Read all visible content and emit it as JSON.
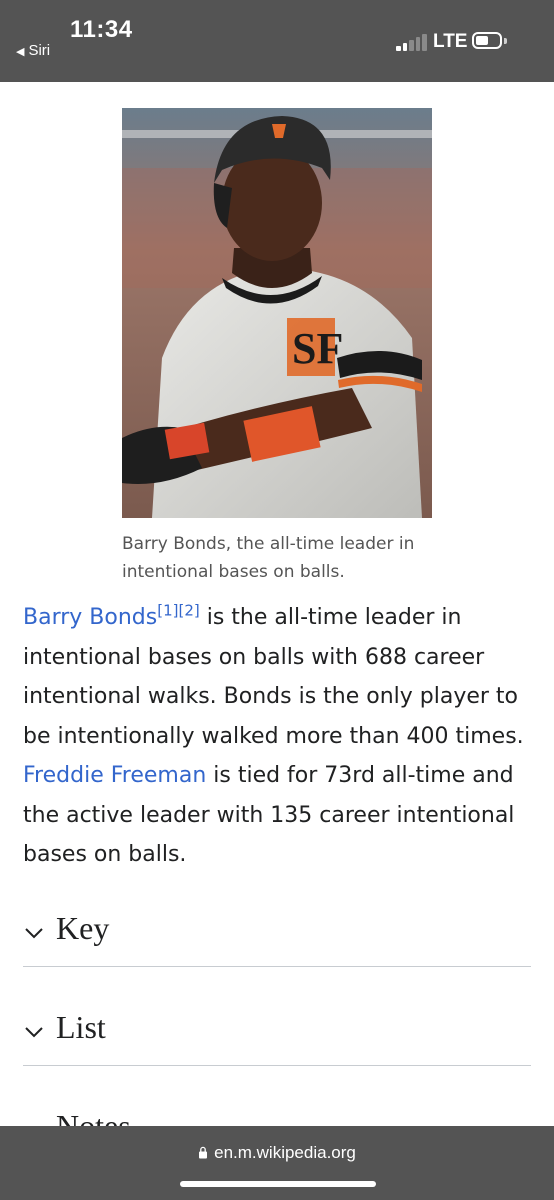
{
  "status_bar": {
    "time": "11:34",
    "back_label": "Siri",
    "network": "LTE"
  },
  "figure": {
    "caption": "Barry Bonds, the all-time leader in intentional bases on balls."
  },
  "paragraph": {
    "link_bonds": "Barry Bonds",
    "ref_1": "[1]",
    "ref_2": "[2]",
    "text_1": " is the all-time leader in intentional bases on balls with 688 career intentional walks. Bonds is the only player to be intentionally walked more than 400 times. ",
    "link_freeman": "Freddie Freeman",
    "text_2": " is tied for 73rd all-time and the active leader with 135 career intentional bases on balls."
  },
  "sections": {
    "key": "Key",
    "list": "List",
    "notes": "Notes"
  },
  "browser": {
    "url": "en.m.wikipedia.org"
  }
}
